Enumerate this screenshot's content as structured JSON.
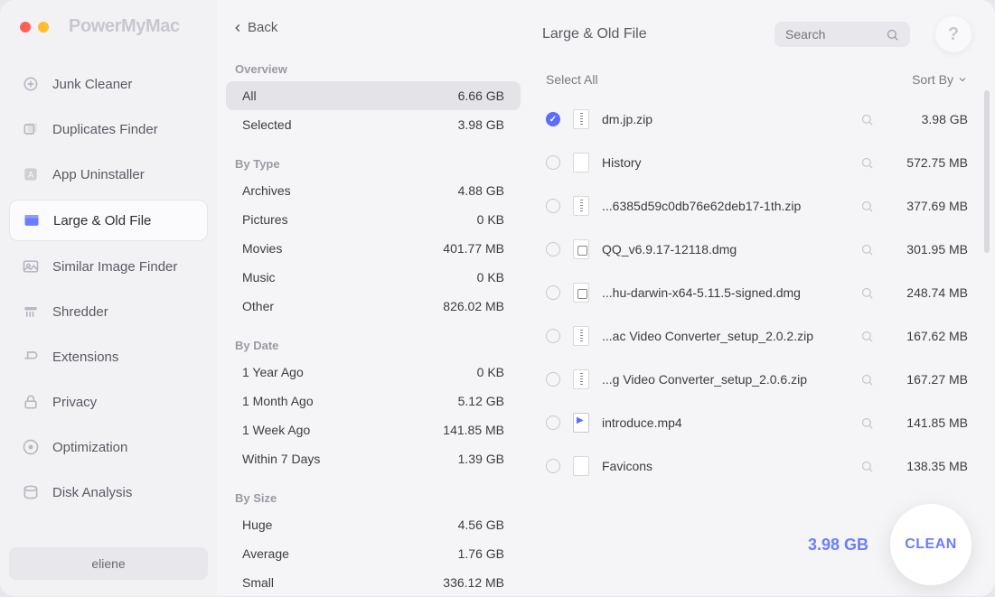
{
  "brand": "PowerMyMac",
  "back_label": "Back",
  "nav": [
    {
      "icon": "broom",
      "label": "Junk Cleaner"
    },
    {
      "icon": "copies",
      "label": "Duplicates Finder"
    },
    {
      "icon": "uninstall",
      "label": "App Uninstaller"
    },
    {
      "icon": "large",
      "label": "Large & Old File"
    },
    {
      "icon": "similar",
      "label": "Similar Image Finder"
    },
    {
      "icon": "shred",
      "label": "Shredder"
    },
    {
      "icon": "ext",
      "label": "Extensions"
    },
    {
      "icon": "lock",
      "label": "Privacy"
    },
    {
      "icon": "opt",
      "label": "Optimization"
    },
    {
      "icon": "disk",
      "label": "Disk Analysis"
    }
  ],
  "active_nav_index": 3,
  "user": "eliene",
  "sections": {
    "overview_title": "Overview",
    "overview": [
      {
        "label": "All",
        "value": "6.66 GB",
        "selected": true
      },
      {
        "label": "Selected",
        "value": "3.98 GB"
      }
    ],
    "bytype_title": "By Type",
    "bytype": [
      {
        "label": "Archives",
        "value": "4.88 GB"
      },
      {
        "label": "Pictures",
        "value": "0 KB"
      },
      {
        "label": "Movies",
        "value": "401.77 MB"
      },
      {
        "label": "Music",
        "value": "0 KB"
      },
      {
        "label": "Other",
        "value": "826.02 MB"
      }
    ],
    "bydate_title": "By Date",
    "bydate": [
      {
        "label": "1 Year Ago",
        "value": "0 KB"
      },
      {
        "label": "1 Month Ago",
        "value": "5.12 GB"
      },
      {
        "label": "1 Week Ago",
        "value": "141.85 MB"
      },
      {
        "label": "Within 7 Days",
        "value": "1.39 GB"
      }
    ],
    "bysize_title": "By Size",
    "bysize": [
      {
        "label": "Huge",
        "value": "4.56 GB"
      },
      {
        "label": "Average",
        "value": "1.76 GB"
      },
      {
        "label": "Small",
        "value": "336.12 MB"
      }
    ]
  },
  "page_title": "Large & Old File",
  "search_placeholder": "Search",
  "select_all_label": "Select All",
  "sort_by_label": "Sort By",
  "files": [
    {
      "checked": true,
      "type": "zip",
      "name": "dm.jp.zip",
      "size": "3.98 GB"
    },
    {
      "checked": false,
      "type": "folder",
      "name": "History",
      "size": "572.75 MB"
    },
    {
      "checked": false,
      "type": "zip",
      "name": "...6385d59c0db76e62deb17-1th.zip",
      "size": "377.69 MB"
    },
    {
      "checked": false,
      "type": "dmg",
      "name": "QQ_v6.9.17-12118.dmg",
      "size": "301.95 MB"
    },
    {
      "checked": false,
      "type": "dmg",
      "name": "...hu-darwin-x64-5.11.5-signed.dmg",
      "size": "248.74 MB"
    },
    {
      "checked": false,
      "type": "zip",
      "name": "...ac Video Converter_setup_2.0.2.zip",
      "size": "167.62 MB"
    },
    {
      "checked": false,
      "type": "zip",
      "name": "...g Video Converter_setup_2.0.6.zip",
      "size": "167.27 MB"
    },
    {
      "checked": false,
      "type": "video",
      "name": "introduce.mp4",
      "size": "141.85 MB"
    },
    {
      "checked": false,
      "type": "folder",
      "name": "Favicons",
      "size": "138.35 MB"
    }
  ],
  "selected_total": "3.98 GB",
  "clean_label": "CLEAN"
}
